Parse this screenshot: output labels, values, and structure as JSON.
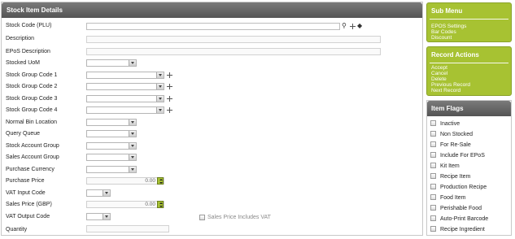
{
  "main": {
    "title": "Stock Item Details",
    "labels": {
      "stock_code": "Stock Code (PLU)",
      "description": "Description",
      "epos_description": "EPoS Description",
      "stocked_uom": "Stocked UoM",
      "group1": "Stock Group Code 1",
      "group2": "Stock Group Code 2",
      "group3": "Stock Group Code 3",
      "group4": "Stock Group Code 4",
      "normal_bin": "Normal Bin Location",
      "query_queue": "Query Queue",
      "stock_account": "Stock Account Group",
      "sales_account": "Sales Account Group",
      "purchase_currency": "Purchase Currency",
      "purchase_price": "Purchase Price",
      "vat_input": "VAT Input Code",
      "sales_price": "Sales Price (GBP)",
      "vat_output": "VAT Output Code",
      "quantity": "Quantity"
    },
    "values": {
      "purchase_price": "0.00",
      "sales_price": "0.00"
    },
    "sales_price_includes_vat": "Sales Price Includes VAT"
  },
  "submenu": {
    "title": "Sub Menu",
    "items": [
      "EPOS Settings",
      "Bar Codes",
      "Discount"
    ]
  },
  "record_actions": {
    "title": "Record Actions",
    "items": [
      "Accept",
      "Cancel",
      "Delete",
      "Previous Record",
      "Next Record"
    ]
  },
  "item_flags": {
    "title": "Item Flags",
    "items": [
      "Inactive",
      "Non Stocked",
      "For Re-Sale",
      "Include For EPoS",
      "Kit Item",
      "Recipe Item",
      "Production Recipe",
      "Food Item",
      "Perishable Food",
      "Auto-Print Barcode",
      "Recipe Ingredient"
    ]
  },
  "icons": {
    "search": "search-icon",
    "add": "plus-icon",
    "diamond": "diamond-icon"
  },
  "colors": {
    "accent_green": "#a7c232",
    "header_gray": "#636363"
  }
}
